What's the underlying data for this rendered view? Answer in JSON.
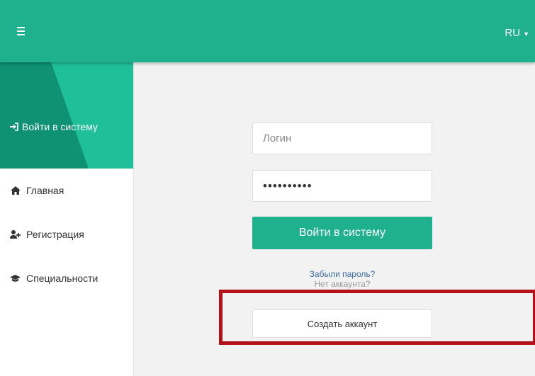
{
  "header": {
    "menu_icon": "hamburger-menu-icon",
    "language": "RU",
    "caret_icon": "caret-down-icon",
    "color": "#1fb08e"
  },
  "sidebar": {
    "active": {
      "label": "Войти в систему",
      "icon": "sign-in-icon"
    },
    "items": [
      {
        "label": "Главная",
        "icon": "home-icon"
      },
      {
        "label": "Регистрация",
        "icon": "user-plus-icon"
      },
      {
        "label": "Специальности",
        "icon": "graduation-cap-icon"
      }
    ]
  },
  "form": {
    "login_placeholder": "Логин",
    "password_value": "••••••••••",
    "submit_label": "Войти в систему",
    "forgot_link": "Забыли пароль?",
    "no_account_text": "Нет аккаунта?",
    "create_account_label": "Создать аккаунт"
  },
  "annotation": {
    "color": "#b4121a"
  }
}
